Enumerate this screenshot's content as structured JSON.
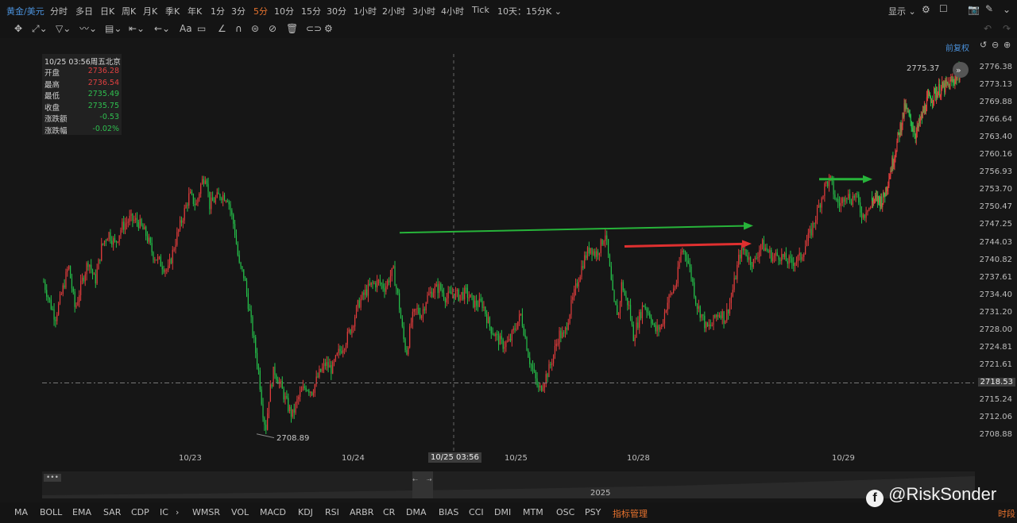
{
  "header": {
    "symbol": "黄金/美元",
    "timeframes": [
      "分时",
      "多日",
      "日K",
      "周K",
      "月K",
      "季K",
      "年K",
      "1分",
      "3分",
      "5分",
      "10分",
      "15分",
      "30分",
      "1小时",
      "2小时",
      "3小时",
      "4小时",
      "Tick"
    ],
    "active_timeframe": "5分",
    "range_select": "10天：15分K",
    "display_label": "显示"
  },
  "toolbar": {
    "fuquan": "前复权"
  },
  "info": {
    "datetime": "10/25 03:56周五北京",
    "rows": [
      {
        "label": "开盘",
        "value": "2736.28",
        "color": "#e04040"
      },
      {
        "label": "最高",
        "value": "2736.54",
        "color": "#e04040"
      },
      {
        "label": "最低",
        "value": "2735.49",
        "color": "#2fbf4f"
      },
      {
        "label": "收盘",
        "value": "2735.75",
        "color": "#2fbf4f"
      },
      {
        "label": "涨跌额",
        "value": "-0.53",
        "color": "#2fbf4f"
      },
      {
        "label": "涨跌幅",
        "value": "-0.02%",
        "color": "#2fbf4f"
      }
    ]
  },
  "axis": {
    "prices": [
      "2776.38",
      "2773.13",
      "2769.88",
      "2766.64",
      "2763.40",
      "2760.16",
      "2756.93",
      "2753.70",
      "2750.47",
      "2747.25",
      "2744.03",
      "2740.82",
      "2737.61",
      "2734.40",
      "2731.20",
      "2728.00",
      "2724.81",
      "2721.61",
      "2718.53",
      "2715.24",
      "2712.06",
      "2708.88"
    ],
    "current_price": "2718.53",
    "dates": [
      "10/23",
      "10/24",
      "10/25",
      "10/28",
      "10/29"
    ],
    "crosshair_date": "10/25 03:56"
  },
  "annotations": {
    "high_label": "2775.37",
    "low_label": "2708.89"
  },
  "navigator": {
    "year": "2025"
  },
  "indicators": [
    "MA",
    "BOLL",
    "EMA",
    "SAR",
    "CDP",
    "IC",
    "WMSR",
    "VOL",
    "MACD",
    "KDJ",
    "RSI",
    "ARBR",
    "CR",
    "DMA",
    "BIAS",
    "CCI",
    "DMI",
    "MTM",
    "OSC",
    "PSY"
  ],
  "indicator_manage": "指标管理",
  "time_period": "时段",
  "watermark": "@RiskSonder",
  "colors": {
    "up": "#e03c3c",
    "down": "#25c04a",
    "bg": "#161616",
    "accent": "#4a90d9",
    "orange": "#e8732e"
  },
  "chart_data": {
    "type": "candlestick",
    "ylim": [
      2708.88,
      2776.38
    ],
    "current_price": 2718.53,
    "path_points": [
      [
        0,
        2737
      ],
      [
        0.008,
        2733
      ],
      [
        0.014,
        2730.5
      ],
      [
        0.022,
        2735
      ],
      [
        0.03,
        2740
      ],
      [
        0.038,
        2732
      ],
      [
        0.046,
        2737
      ],
      [
        0.054,
        2741
      ],
      [
        0.062,
        2737
      ],
      [
        0.07,
        2743.5
      ],
      [
        0.078,
        2746
      ],
      [
        0.086,
        2744
      ],
      [
        0.094,
        2747
      ],
      [
        0.104,
        2748.5
      ],
      [
        0.114,
        2748
      ],
      [
        0.124,
        2745.5
      ],
      [
        0.132,
        2742
      ],
      [
        0.138,
        2741
      ],
      [
        0.144,
        2740
      ],
      [
        0.15,
        2739
      ],
      [
        0.16,
        2745
      ],
      [
        0.168,
        2749
      ],
      [
        0.176,
        2753
      ],
      [
        0.184,
        2751
      ],
      [
        0.19,
        2755
      ],
      [
        0.196,
        2757
      ],
      [
        0.2,
        2751
      ],
      [
        0.206,
        2752
      ],
      [
        0.214,
        2753
      ],
      [
        0.222,
        2752.5
      ],
      [
        0.23,
        2747
      ],
      [
        0.236,
        2740
      ],
      [
        0.242,
        2738
      ],
      [
        0.248,
        2732
      ],
      [
        0.254,
        2726
      ],
      [
        0.26,
        2720
      ],
      [
        0.264,
        2714
      ],
      [
        0.268,
        2710
      ],
      [
        0.272,
        2716
      ],
      [
        0.278,
        2721
      ],
      [
        0.286,
        2718
      ],
      [
        0.294,
        2714.5
      ],
      [
        0.3,
        2712.5
      ],
      [
        0.308,
        2716
      ],
      [
        0.316,
        2718
      ],
      [
        0.324,
        2717
      ],
      [
        0.332,
        2720
      ],
      [
        0.34,
        2722
      ],
      [
        0.348,
        2721
      ],
      [
        0.356,
        2724
      ],
      [
        0.364,
        2726
      ],
      [
        0.372,
        2729
      ],
      [
        0.38,
        2733
      ],
      [
        0.388,
        2735
      ],
      [
        0.396,
        2736.5
      ],
      [
        0.404,
        2737
      ],
      [
        0.412,
        2736
      ],
      [
        0.418,
        2738
      ],
      [
        0.422,
        2739
      ],
      [
        0.428,
        2734
      ],
      [
        0.434,
        2727
      ],
      [
        0.438,
        2724
      ],
      [
        0.444,
        2730
      ],
      [
        0.45,
        2732
      ],
      [
        0.456,
        2731
      ],
      [
        0.462,
        2734
      ],
      [
        0.47,
        2735.5
      ],
      [
        0.478,
        2736
      ],
      [
        0.486,
        2734
      ],
      [
        0.494,
        2735
      ],
      [
        0.5,
        2734.5
      ],
      [
        0.51,
        2735
      ],
      [
        0.52,
        2733
      ],
      [
        0.53,
        2733
      ],
      [
        0.538,
        2729
      ],
      [
        0.546,
        2727
      ],
      [
        0.554,
        2725.5
      ],
      [
        0.562,
        2726
      ],
      [
        0.57,
        2729
      ],
      [
        0.576,
        2731
      ],
      [
        0.58,
        2728
      ],
      [
        0.586,
        2723
      ],
      [
        0.592,
        2720
      ],
      [
        0.598,
        2717
      ],
      [
        0.604,
        2719
      ],
      [
        0.61,
        2721
      ],
      [
        0.616,
        2724
      ],
      [
        0.622,
        2727.5
      ],
      [
        0.628,
        2727
      ],
      [
        0.634,
        2731
      ],
      [
        0.64,
        2734.5
      ],
      [
        0.646,
        2738
      ],
      [
        0.652,
        2741
      ],
      [
        0.66,
        2743.5
      ],
      [
        0.666,
        2742
      ],
      [
        0.672,
        2743.5
      ],
      [
        0.678,
        2746
      ],
      [
        0.682,
        2741
      ],
      [
        0.688,
        2733
      ],
      [
        0.694,
        2731
      ],
      [
        0.698,
        2737
      ],
      [
        0.702,
        2734
      ],
      [
        0.706,
        2733
      ],
      [
        0.712,
        2727
      ],
      [
        0.718,
        2730
      ],
      [
        0.724,
        2733
      ],
      [
        0.732,
        2731
      ],
      [
        0.738,
        2728
      ],
      [
        0.746,
        2729
      ],
      [
        0.752,
        2733
      ],
      [
        0.758,
        2735
      ],
      [
        0.764,
        2737
      ],
      [
        0.77,
        2743
      ],
      [
        0.776,
        2742
      ],
      [
        0.782,
        2738
      ],
      [
        0.788,
        2733
      ],
      [
        0.794,
        2731
      ],
      [
        0.8,
        2728.5
      ],
      [
        0.806,
        2729
      ],
      [
        0.812,
        2731
      ],
      [
        0.818,
        2731.5
      ],
      [
        0.822,
        2730
      ],
      [
        0.828,
        2733
      ],
      [
        0.834,
        2737
      ],
      [
        0.84,
        2742
      ],
      [
        0.846,
        2743
      ],
      [
        0.852,
        2741
      ],
      [
        0.858,
        2740.5
      ],
      [
        0.866,
        2744
      ],
      [
        0.872,
        2743
      ],
      [
        0.88,
        2741.5
      ],
      [
        0.888,
        2742
      ],
      [
        0.896,
        2741
      ],
      [
        0.902,
        2740.5
      ],
      [
        0.908,
        2741
      ],
      [
        0.914,
        2741.5
      ],
      [
        0.92,
        2744
      ],
      [
        0.926,
        2746
      ],
      [
        0.932,
        2749
      ],
      [
        0.938,
        2752
      ],
      [
        0.944,
        2755
      ],
      [
        0.95,
        2755.5
      ],
      [
        0.956,
        2752
      ],
      [
        0.962,
        2751
      ],
      [
        0.968,
        2753.5
      ],
      [
        0.974,
        2752
      ],
      [
        0.98,
        2753
      ],
      [
        0.986,
        2750
      ],
      [
        0.99,
        2749
      ],
      [
        0.994,
        2751
      ],
      [
        0.998,
        2750.5
      ],
      [
        1.0,
        2752
      ]
    ],
    "arrows": [
      {
        "color": "#27b43a",
        "from": [
          2746.0
        ],
        "to": [
          2747.3
        ]
      },
      {
        "color": "#e03030",
        "from": [
          2743.5
        ],
        "to": [
          2744.0
        ]
      },
      {
        "color": "#27b43a",
        "from": [
          2755.8
        ],
        "to": [
          2755.8
        ]
      }
    ]
  }
}
